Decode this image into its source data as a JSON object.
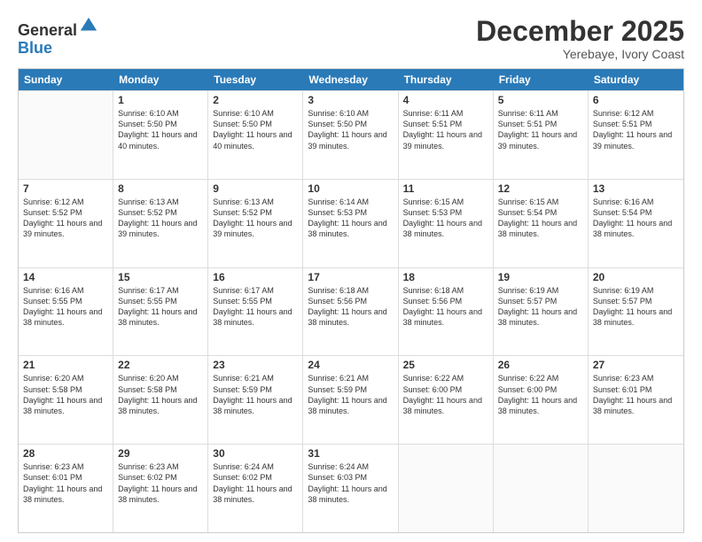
{
  "logo": {
    "line1": "General",
    "line2": "Blue"
  },
  "header": {
    "month": "December 2025",
    "location": "Yerebaye, Ivory Coast"
  },
  "days": [
    "Sunday",
    "Monday",
    "Tuesday",
    "Wednesday",
    "Thursday",
    "Friday",
    "Saturday"
  ],
  "rows": [
    [
      {
        "day": "",
        "empty": true
      },
      {
        "day": "1",
        "sunrise": "6:10 AM",
        "sunset": "5:50 PM",
        "daylight": "11 hours and 40 minutes."
      },
      {
        "day": "2",
        "sunrise": "6:10 AM",
        "sunset": "5:50 PM",
        "daylight": "11 hours and 40 minutes."
      },
      {
        "day": "3",
        "sunrise": "6:10 AM",
        "sunset": "5:50 PM",
        "daylight": "11 hours and 39 minutes."
      },
      {
        "day": "4",
        "sunrise": "6:11 AM",
        "sunset": "5:51 PM",
        "daylight": "11 hours and 39 minutes."
      },
      {
        "day": "5",
        "sunrise": "6:11 AM",
        "sunset": "5:51 PM",
        "daylight": "11 hours and 39 minutes."
      },
      {
        "day": "6",
        "sunrise": "6:12 AM",
        "sunset": "5:51 PM",
        "daylight": "11 hours and 39 minutes."
      }
    ],
    [
      {
        "day": "7",
        "sunrise": "6:12 AM",
        "sunset": "5:52 PM",
        "daylight": "11 hours and 39 minutes."
      },
      {
        "day": "8",
        "sunrise": "6:13 AM",
        "sunset": "5:52 PM",
        "daylight": "11 hours and 39 minutes."
      },
      {
        "day": "9",
        "sunrise": "6:13 AM",
        "sunset": "5:52 PM",
        "daylight": "11 hours and 39 minutes."
      },
      {
        "day": "10",
        "sunrise": "6:14 AM",
        "sunset": "5:53 PM",
        "daylight": "11 hours and 38 minutes."
      },
      {
        "day": "11",
        "sunrise": "6:15 AM",
        "sunset": "5:53 PM",
        "daylight": "11 hours and 38 minutes."
      },
      {
        "day": "12",
        "sunrise": "6:15 AM",
        "sunset": "5:54 PM",
        "daylight": "11 hours and 38 minutes."
      },
      {
        "day": "13",
        "sunrise": "6:16 AM",
        "sunset": "5:54 PM",
        "daylight": "11 hours and 38 minutes."
      }
    ],
    [
      {
        "day": "14",
        "sunrise": "6:16 AM",
        "sunset": "5:55 PM",
        "daylight": "11 hours and 38 minutes."
      },
      {
        "day": "15",
        "sunrise": "6:17 AM",
        "sunset": "5:55 PM",
        "daylight": "11 hours and 38 minutes."
      },
      {
        "day": "16",
        "sunrise": "6:17 AM",
        "sunset": "5:55 PM",
        "daylight": "11 hours and 38 minutes."
      },
      {
        "day": "17",
        "sunrise": "6:18 AM",
        "sunset": "5:56 PM",
        "daylight": "11 hours and 38 minutes."
      },
      {
        "day": "18",
        "sunrise": "6:18 AM",
        "sunset": "5:56 PM",
        "daylight": "11 hours and 38 minutes."
      },
      {
        "day": "19",
        "sunrise": "6:19 AM",
        "sunset": "5:57 PM",
        "daylight": "11 hours and 38 minutes."
      },
      {
        "day": "20",
        "sunrise": "6:19 AM",
        "sunset": "5:57 PM",
        "daylight": "11 hours and 38 minutes."
      }
    ],
    [
      {
        "day": "21",
        "sunrise": "6:20 AM",
        "sunset": "5:58 PM",
        "daylight": "11 hours and 38 minutes."
      },
      {
        "day": "22",
        "sunrise": "6:20 AM",
        "sunset": "5:58 PM",
        "daylight": "11 hours and 38 minutes."
      },
      {
        "day": "23",
        "sunrise": "6:21 AM",
        "sunset": "5:59 PM",
        "daylight": "11 hours and 38 minutes."
      },
      {
        "day": "24",
        "sunrise": "6:21 AM",
        "sunset": "5:59 PM",
        "daylight": "11 hours and 38 minutes."
      },
      {
        "day": "25",
        "sunrise": "6:22 AM",
        "sunset": "6:00 PM",
        "daylight": "11 hours and 38 minutes."
      },
      {
        "day": "26",
        "sunrise": "6:22 AM",
        "sunset": "6:00 PM",
        "daylight": "11 hours and 38 minutes."
      },
      {
        "day": "27",
        "sunrise": "6:23 AM",
        "sunset": "6:01 PM",
        "daylight": "11 hours and 38 minutes."
      }
    ],
    [
      {
        "day": "28",
        "sunrise": "6:23 AM",
        "sunset": "6:01 PM",
        "daylight": "11 hours and 38 minutes."
      },
      {
        "day": "29",
        "sunrise": "6:23 AM",
        "sunset": "6:02 PM",
        "daylight": "11 hours and 38 minutes."
      },
      {
        "day": "30",
        "sunrise": "6:24 AM",
        "sunset": "6:02 PM",
        "daylight": "11 hours and 38 minutes."
      },
      {
        "day": "31",
        "sunrise": "6:24 AM",
        "sunset": "6:03 PM",
        "daylight": "11 hours and 38 minutes."
      },
      {
        "day": "",
        "empty": true
      },
      {
        "day": "",
        "empty": true
      },
      {
        "day": "",
        "empty": true
      }
    ]
  ],
  "labels": {
    "sunrise": "Sunrise:",
    "sunset": "Sunset:",
    "daylight": "Daylight:"
  }
}
